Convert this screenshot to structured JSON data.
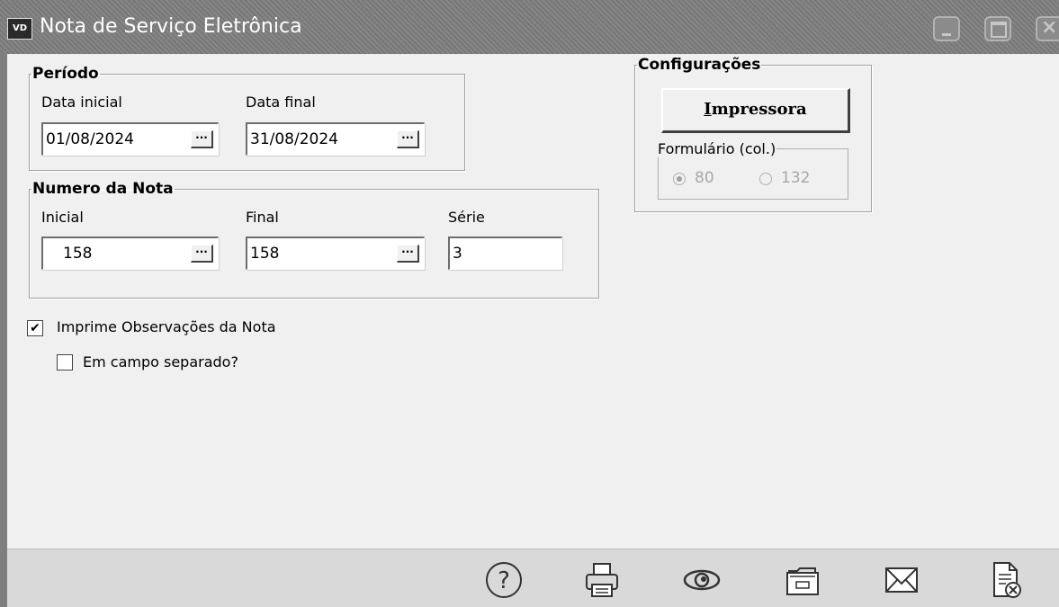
{
  "window": {
    "icon_text": "VD",
    "title": "Nota de Serviço Eletrônica"
  },
  "periodo": {
    "legend": "Período",
    "data_inicial_label": "Data inicial",
    "data_inicial_value": "01/08/2024",
    "data_final_label": "Data final",
    "data_final_value": "31/08/2024"
  },
  "numero_nota": {
    "legend": "Numero da Nota",
    "inicial_label": "Inicial",
    "inicial_value": "158",
    "final_label": "Final",
    "final_value": "158",
    "serie_label": "Série",
    "serie_value": "3"
  },
  "configuracoes": {
    "legend": "Configurações",
    "impressora_button_first": "I",
    "impressora_button_rest": "mpressora",
    "formulario_legend": "Formulário (col.)",
    "options": [
      "80",
      "132"
    ],
    "selected": "80"
  },
  "options": {
    "imprime_observacoes_label": "Imprime Observações da Nota",
    "imprime_observacoes_checked": true,
    "campo_separado_label": "Em campo separado?",
    "campo_separado_checked": false
  },
  "ellipsis": "···",
  "toolbar_icons": [
    "help-icon",
    "printer-icon",
    "preview-eye-icon",
    "archive-icon",
    "email-icon",
    "close-document-icon"
  ],
  "colors": {
    "titlebar": "#7e7e7e",
    "background": "#f0f0f0",
    "toolbar": "#d9d9d9"
  }
}
